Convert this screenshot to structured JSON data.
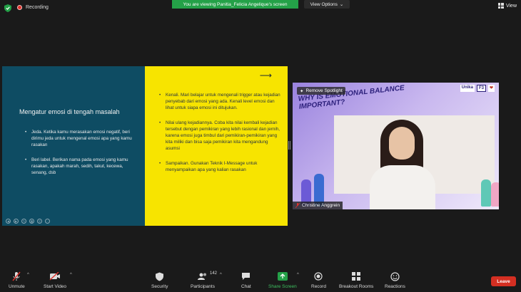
{
  "top": {
    "recording_label": "Recording",
    "viewing_banner": "You are viewing Panitia_Felicia Angelique's screen",
    "view_options_label": "View Options",
    "view_label": "View"
  },
  "slide": {
    "left_title": "Mengatur emosi di tengah masalah",
    "left_bullets": [
      "Jeda. Ketika kamu merasakan emosi negatif, beri dirimu jeda untuk mengenal emosi apa yang kamu rasakan",
      "Beri label. Berikan nama pada emosi yang kamu rasakan, apakah marah, sedih, takut, kecewa, senang, dsb"
    ],
    "right_bullets": [
      "Kenali. Mari belajar untuk mengenali trigger atau kejadian penyebab dari emosi yang ada. Kenali level emosi dan lihat untuk siapa emosi ini ditujukan.",
      "Nilai ulang kejadiannya. Coba kita nilai kembali kejadian tersebut dengan pemikiran yang lebih rasional dan jernih, karena emosi juga timbul dari pemikiran-pemikiran yang kita miliki dan bisa saja pemikiran kita mengandung asumsi",
      "Sampaikan. Gunakan Teknik I-Message untuk menyampaikan apa yang kalian rasakan"
    ]
  },
  "video": {
    "title": "WHY IS EMOTIONAL BALANCE IMPORTANT?",
    "logos": [
      "Unika",
      "F3",
      "❤"
    ],
    "remove_spotlight_label": "Remove Spotlight",
    "participant_name": "Christine Anggrein"
  },
  "toolbar": {
    "unmute": "Unmute",
    "start_video": "Start Video",
    "security": "Security",
    "participants": "Participants",
    "participants_count": "142",
    "chat": "Chat",
    "share_screen": "Share Screen",
    "record": "Record",
    "breakout_rooms": "Breakout Rooms",
    "reactions": "Reactions",
    "leave": "Leave"
  },
  "colors": {
    "slide_left_bg": "#0e4c63",
    "slide_right_bg": "#f7e400",
    "banner_green": "#24a148",
    "leave_red": "#d42f22",
    "share_green": "#24a148"
  }
}
